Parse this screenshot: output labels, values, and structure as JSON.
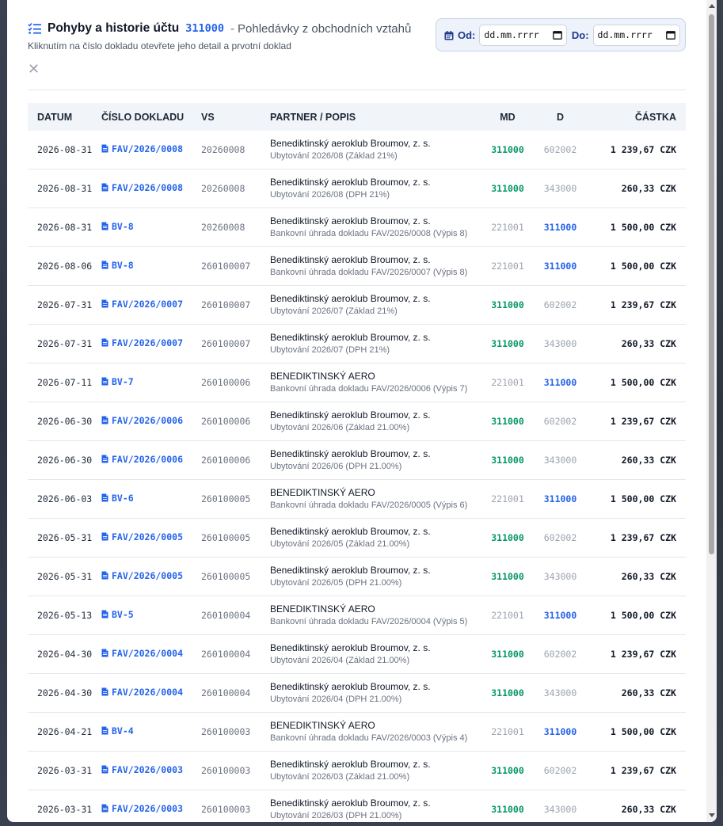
{
  "header": {
    "title": "Pohyby a historie účtu",
    "account_code": "311000",
    "separator": "-",
    "account_name": "Pohledávky z obchodních vztahů",
    "subtitle": "Kliknutím na číslo dokladu otevřete jeho detail a prvotní doklad"
  },
  "date_filter": {
    "from_label": "Od:",
    "to_label": "Do:",
    "from_placeholder": "dd.mm.rrrr",
    "to_placeholder": "dd.mm.rrrr"
  },
  "close_label": "✕",
  "columns": {
    "date": "DATUM",
    "doc": "ČÍSLO DOKLADU",
    "vs": "VS",
    "partner": "PARTNER / POPIS",
    "md": "MD",
    "d": "D",
    "amount": "ČÁSTKA"
  },
  "rows": [
    {
      "date": "2026-08-31",
      "doc": "FAV/2026/0008",
      "vs": "20260008",
      "partner": "Benediktinský aeroklub Broumov, z. s.",
      "desc": "Ubytování 2026/08 (Základ 21%)",
      "md": "311000",
      "md_style": "green",
      "d": "602002",
      "d_style": "grey",
      "amount": "1 239,67 CZK"
    },
    {
      "date": "2026-08-31",
      "doc": "FAV/2026/0008",
      "vs": "20260008",
      "partner": "Benediktinský aeroklub Broumov, z. s.",
      "desc": "Ubytování 2026/08 (DPH 21%)",
      "md": "311000",
      "md_style": "green",
      "d": "343000",
      "d_style": "grey",
      "amount": "260,33 CZK"
    },
    {
      "date": "2026-08-31",
      "doc": "BV-8",
      "vs": "20260008",
      "partner": "Benediktinský aeroklub Broumov, z. s.",
      "desc": "Bankovní úhrada dokladu FAV/2026/0008 (Výpis 8)",
      "md": "221001",
      "md_style": "grey",
      "d": "311000",
      "d_style": "blue",
      "amount": "1 500,00 CZK"
    },
    {
      "date": "2026-08-06",
      "doc": "BV-8",
      "vs": "260100007",
      "partner": "Benediktinský aeroklub Broumov, z. s.",
      "desc": "Bankovní úhrada dokladu FAV/2026/0007 (Výpis 8)",
      "md": "221001",
      "md_style": "grey",
      "d": "311000",
      "d_style": "blue",
      "amount": "1 500,00 CZK"
    },
    {
      "date": "2026-07-31",
      "doc": "FAV/2026/0007",
      "vs": "260100007",
      "partner": "Benediktinský aeroklub Broumov, z. s.",
      "desc": "Ubytování 2026/07 (Základ 21%)",
      "md": "311000",
      "md_style": "green",
      "d": "602002",
      "d_style": "grey",
      "amount": "1 239,67 CZK"
    },
    {
      "date": "2026-07-31",
      "doc": "FAV/2026/0007",
      "vs": "260100007",
      "partner": "Benediktinský aeroklub Broumov, z. s.",
      "desc": "Ubytování 2026/07 (DPH 21%)",
      "md": "311000",
      "md_style": "green",
      "d": "343000",
      "d_style": "grey",
      "amount": "260,33 CZK"
    },
    {
      "date": "2026-07-11",
      "doc": "BV-7",
      "vs": "260100006",
      "partner": "BENEDIKTINSKÝ AERO",
      "desc": "Bankovní úhrada dokladu FAV/2026/0006 (Výpis 7)",
      "md": "221001",
      "md_style": "grey",
      "d": "311000",
      "d_style": "blue",
      "amount": "1 500,00 CZK"
    },
    {
      "date": "2026-06-30",
      "doc": "FAV/2026/0006",
      "vs": "260100006",
      "partner": "Benediktinský aeroklub Broumov, z. s.",
      "desc": "Ubytování 2026/06 (Základ 21.00%)",
      "md": "311000",
      "md_style": "green",
      "d": "602002",
      "d_style": "grey",
      "amount": "1 239,67 CZK"
    },
    {
      "date": "2026-06-30",
      "doc": "FAV/2026/0006",
      "vs": "260100006",
      "partner": "Benediktinský aeroklub Broumov, z. s.",
      "desc": "Ubytování 2026/06 (DPH 21.00%)",
      "md": "311000",
      "md_style": "green",
      "d": "343000",
      "d_style": "grey",
      "amount": "260,33 CZK"
    },
    {
      "date": "2026-06-03",
      "doc": "BV-6",
      "vs": "260100005",
      "partner": "BENEDIKTINSKÝ AERO",
      "desc": "Bankovní úhrada dokladu FAV/2026/0005 (Výpis 6)",
      "md": "221001",
      "md_style": "grey",
      "d": "311000",
      "d_style": "blue",
      "amount": "1 500,00 CZK"
    },
    {
      "date": "2026-05-31",
      "doc": "FAV/2026/0005",
      "vs": "260100005",
      "partner": "Benediktinský aeroklub Broumov, z. s.",
      "desc": "Ubytování 2026/05 (Základ 21.00%)",
      "md": "311000",
      "md_style": "green",
      "d": "602002",
      "d_style": "grey",
      "amount": "1 239,67 CZK"
    },
    {
      "date": "2026-05-31",
      "doc": "FAV/2026/0005",
      "vs": "260100005",
      "partner": "Benediktinský aeroklub Broumov, z. s.",
      "desc": "Ubytování 2026/05 (DPH 21.00%)",
      "md": "311000",
      "md_style": "green",
      "d": "343000",
      "d_style": "grey",
      "amount": "260,33 CZK"
    },
    {
      "date": "2026-05-13",
      "doc": "BV-5",
      "vs": "260100004",
      "partner": "BENEDIKTINSKÝ AERO",
      "desc": "Bankovní úhrada dokladu FAV/2026/0004 (Výpis 5)",
      "md": "221001",
      "md_style": "grey",
      "d": "311000",
      "d_style": "blue",
      "amount": "1 500,00 CZK"
    },
    {
      "date": "2026-04-30",
      "doc": "FAV/2026/0004",
      "vs": "260100004",
      "partner": "Benediktinský aeroklub Broumov, z. s.",
      "desc": "Ubytování 2026/04 (Základ 21.00%)",
      "md": "311000",
      "md_style": "green",
      "d": "602002",
      "d_style": "grey",
      "amount": "1 239,67 CZK"
    },
    {
      "date": "2026-04-30",
      "doc": "FAV/2026/0004",
      "vs": "260100004",
      "partner": "Benediktinský aeroklub Broumov, z. s.",
      "desc": "Ubytování 2026/04 (DPH 21.00%)",
      "md": "311000",
      "md_style": "green",
      "d": "343000",
      "d_style": "grey",
      "amount": "260,33 CZK"
    },
    {
      "date": "2026-04-21",
      "doc": "BV-4",
      "vs": "260100003",
      "partner": "BENEDIKTINSKÝ AERO",
      "desc": "Bankovní úhrada dokladu FAV/2026/0003 (Výpis 4)",
      "md": "221001",
      "md_style": "grey",
      "d": "311000",
      "d_style": "blue",
      "amount": "1 500,00 CZK"
    },
    {
      "date": "2026-03-31",
      "doc": "FAV/2026/0003",
      "vs": "260100003",
      "partner": "Benediktinský aeroklub Broumov, z. s.",
      "desc": "Ubytování 2026/03 (Základ 21.00%)",
      "md": "311000",
      "md_style": "green",
      "d": "602002",
      "d_style": "grey",
      "amount": "1 239,67 CZK"
    },
    {
      "date": "2026-03-31",
      "doc": "FAV/2026/0003",
      "vs": "260100003",
      "partner": "Benediktinský aeroklub Broumov, z. s.",
      "desc": "Ubytování 2026/03 (DPH 21.00%)",
      "md": "311000",
      "md_style": "green",
      "d": "343000",
      "d_style": "grey",
      "amount": "260,33 CZK"
    }
  ]
}
